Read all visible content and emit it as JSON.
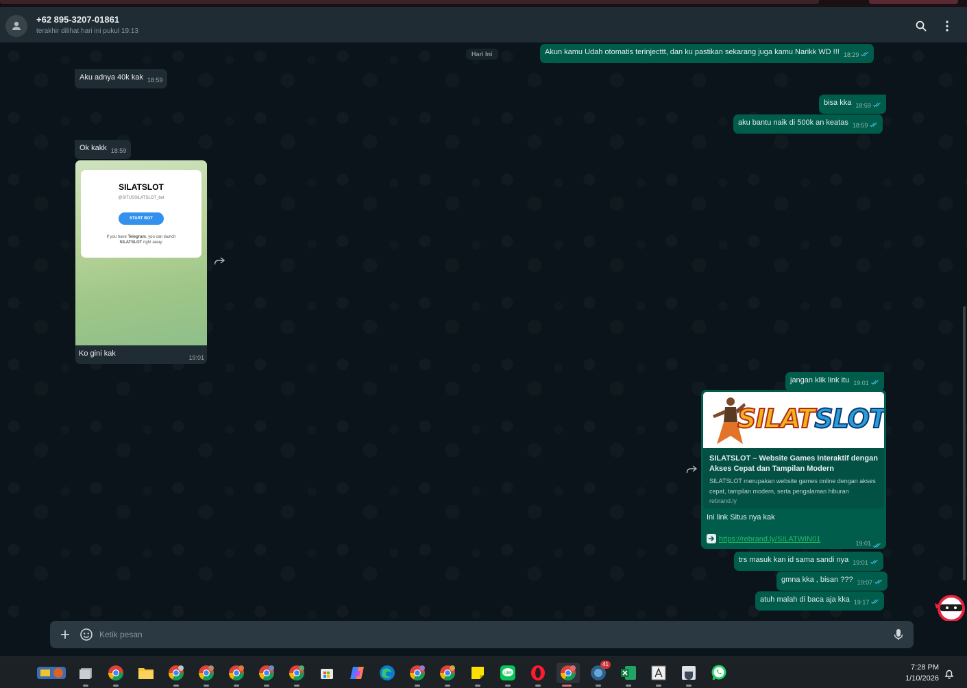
{
  "header": {
    "contact_name": "+62 895-3207-01861",
    "status": "terakhir dilihat hari ini pukul 19:13",
    "icons": [
      "search-icon",
      "menu-icon"
    ]
  },
  "chat": {
    "day_chip": "Hari Ini",
    "messages": [
      {
        "dir": "out",
        "text": "Akun kamu Udah otomatis terinjecttt, dan ku pastikan sekarang juga kamu Narikk WD !!!",
        "time": "18:29"
      },
      {
        "dir": "in",
        "text": "Aku adnya 40k kak",
        "time": "18:59"
      },
      {
        "dir": "out",
        "text": "bisa kka",
        "time": "18:59"
      },
      {
        "dir": "out",
        "text": "aku bantu naik di 500k an keatas",
        "time": "18:59"
      },
      {
        "dir": "in",
        "text": "Ok kakk",
        "time": "18:59"
      },
      {
        "dir": "out",
        "text": "jangan klik link itu",
        "time": "19:01"
      },
      {
        "dir": "out",
        "text": "trs masuk kan id sama sandi nya",
        "time": "19:01"
      },
      {
        "dir": "out",
        "text": "gmna kka , bisan ???",
        "time": "19:07"
      },
      {
        "dir": "out",
        "text": "atuh malah di baca aja kka",
        "time": "19:17"
      }
    ],
    "image_message": {
      "caption": "Ko gini kak",
      "time": "19:01",
      "card_title": "SILATSLOT",
      "card_handle": "@SITUSSILATSLOT_bot",
      "card_button": "START BOT",
      "card_note_1": "If you have",
      "card_note_telegram": "Telegram",
      "card_note_2": ", you can launch",
      "card_note_3_bold": "SILATSLOT",
      "card_note_4": " right away."
    },
    "link_message": {
      "banner_logo_part1": "SILAT",
      "banner_logo_part2": "SLOT",
      "preview_title": "SILATSLOT – Website Games Interaktif dengan Akses Cepat dan Tampilan Modern",
      "preview_desc": "SILATSLOT merupakan website games online dengan akses cepat, tampilan modern, serta pengalaman hiburan",
      "preview_domain": "rebrand.ly",
      "text": "Ini link Situs nya kak",
      "url": "https://rebrand.ly/SILATWIN01",
      "time": "19:01"
    }
  },
  "composer": {
    "placeholder": "Ketik pesan",
    "value": ""
  },
  "taskbar": {
    "apps": [
      "game-icon",
      "windows-icon",
      "chrome-icon",
      "file-explorer-icon",
      "chrome-profile-icon",
      "chrome-profile-icon",
      "chrome-profile-icon",
      "chrome-profile-icon",
      "chrome-profile-icon",
      "microsoft-store-icon",
      "copilot-icon",
      "edge-icon",
      "chrome-profile-icon",
      "chrome-profile-icon",
      "sticky-notes-icon",
      "line-icon",
      "opera-icon",
      "chrome-profile-icon",
      "browser-icon",
      "excel-icon",
      "font-icon",
      "app-icon",
      "whatsapp-icon"
    ],
    "badge_count": "41",
    "time": "7:28 PM",
    "date": "1/10/2026"
  },
  "colors": {
    "incoming_bubble": "#202c33",
    "outgoing_bubble": "#005c4b",
    "header_bg": "#202c33",
    "chat_bg": "#0b141a",
    "read_ticks": "#53bdeb"
  }
}
